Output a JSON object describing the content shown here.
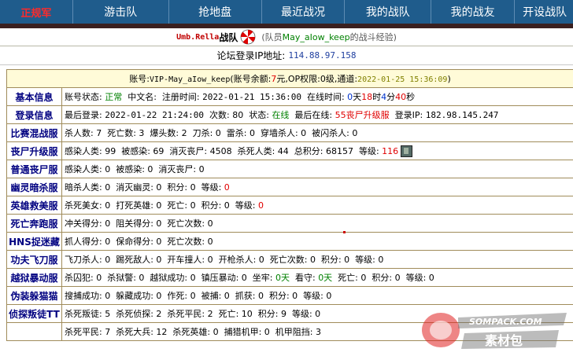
{
  "topnav": {
    "brand": "正规军",
    "items": [
      "游击队",
      "抢地盘",
      "最近战况",
      "我的战队",
      "我的战友",
      "开设战队"
    ]
  },
  "title": {
    "name": "Umb.Rella",
    "suffix": "战队",
    "sub_prefix": "(队员",
    "member": "May_aIow_keep",
    "sub_suffix": "的战斗经验)"
  },
  "ipbar": {
    "label": "论坛登录IP地址:",
    "ip": "114.88.97.158"
  },
  "account": {
    "p1": "账号:",
    "account_name": "VIP-May_aIow_keep",
    "p2": "(账号余额:",
    "balance": "7",
    "p3": "元,OP权限:",
    "op_level": "0级",
    "p4": ",通道:",
    "channel_time": "2022-01-25 15:36:09",
    "p5": ")"
  },
  "rows": [
    {
      "label": "基本信息",
      "segments": [
        {
          "t": "账号状态: "
        },
        {
          "t": "正常",
          "c": "green"
        },
        {
          "t": "  中文名:  注册时间: "
        },
        {
          "t": "2022-01-21 15:36:00",
          "c": "mono"
        },
        {
          "t": "  在线时间: "
        },
        {
          "t": "0",
          "c": "blue"
        },
        {
          "t": "天"
        },
        {
          "t": "18",
          "c": "red"
        },
        {
          "t": "时"
        },
        {
          "t": "4",
          "c": "blue"
        },
        {
          "t": "分"
        },
        {
          "t": "40",
          "c": "red"
        },
        {
          "t": "秒"
        }
      ]
    },
    {
      "label": "登录信息",
      "segments": [
        {
          "t": "最后登录: "
        },
        {
          "t": "2022-01-22 21:24:00",
          "c": "mono"
        },
        {
          "t": "  次数: 80  状态: "
        },
        {
          "t": "在线",
          "c": "green"
        },
        {
          "t": "  最后在线: "
        },
        {
          "t": "55丧尸升级服",
          "c": "red"
        },
        {
          "t": "  登录IP: "
        },
        {
          "t": "182.98.145.247",
          "c": "mono"
        }
      ]
    },
    {
      "label": "比赛混战服",
      "segments": [
        {
          "t": "杀人数: 7  死亡数: 3  爆头数: 2  刀杀: 0  雷杀: 0  穿墙杀人: 0  被闪杀人: 0"
        }
      ]
    },
    {
      "label": "丧尸升级服",
      "segments": [
        {
          "t": "感染人类: 99  被感染: 69  消灭丧尸: 4508  杀死人类: 44  总积分: 68157  等级: "
        },
        {
          "t": "116",
          "c": "red"
        },
        {
          "t": "",
          "c": "rank"
        }
      ]
    },
    {
      "label": "普通丧尸服",
      "segments": [
        {
          "t": "感染人类: 0  被感染: 0  消灭丧尸: 0"
        }
      ]
    },
    {
      "label": "幽灵暗杀服",
      "segments": [
        {
          "t": "暗杀人类: 0  消灭幽灵: 0  积分: 0  等级: "
        },
        {
          "t": "0",
          "c": "red"
        }
      ]
    },
    {
      "label": "英雄救美服",
      "segments": [
        {
          "t": "杀死美女: 0  打死英雄: 0  死亡: 0  积分: 0  等级: "
        },
        {
          "t": "0",
          "c": "red"
        }
      ]
    },
    {
      "label": "死亡奔跑服",
      "segments": [
        {
          "t": "冲关得分: 0  阻关得分: 0  死亡次数: 0"
        }
      ]
    },
    {
      "label": "HNS捉迷藏",
      "segments": [
        {
          "t": "抓人得分: 0  保命得分: 0  死亡次数: 0"
        }
      ]
    },
    {
      "label": "功夫飞刀服",
      "segments": [
        {
          "t": "飞刀杀人: 0  踢死敌人: 0  开车撞人: 0  开枪杀人: 0  死亡次数: 0  积分: 0  等级: 0"
        }
      ]
    },
    {
      "label": "越狱暴动服",
      "segments": [
        {
          "t": "杀囚犯: 0  杀狱警: 0  越狱成功: 0  镇压暴动: 0  坐牢: "
        },
        {
          "t": "0天",
          "c": "green"
        },
        {
          "t": "  看守: "
        },
        {
          "t": "0天",
          "c": "green"
        },
        {
          "t": "  死亡: 0  积分: 0  等级: 0"
        }
      ]
    },
    {
      "label": "伪装躲猫猫",
      "segments": [
        {
          "t": "搜捕成功: 0  躲藏成功: 0  作死: 0  被捕: 0  抓获: 0  积分: 0  等级: 0"
        }
      ]
    },
    {
      "label": "侦探叛徒TT",
      "segments": [
        {
          "t": "杀死叛徒: 5  杀死侦探: 2  杀死平民: 2  死亡: 10  积分: 9  等级: 0"
        }
      ]
    },
    {
      "label": "",
      "segments": [
        {
          "t": "杀死平民: 7  杀死大兵: 12  杀死英雄: 0  捕猎机甲: 0  机甲阻挡: 3"
        }
      ]
    }
  ],
  "watermark": {
    "line1": "SOMPACK.COM",
    "line2": "素材包"
  }
}
